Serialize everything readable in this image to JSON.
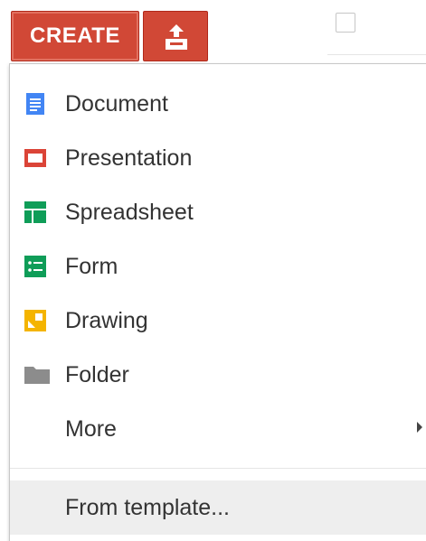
{
  "toolbar": {
    "create_label": "CREATE",
    "upload_icon": "upload-icon",
    "select_checkbox_checked": false
  },
  "menu": {
    "items": [
      {
        "label": "Document",
        "icon": "document-icon",
        "color": "#4285f4"
      },
      {
        "label": "Presentation",
        "icon": "presentation-icon",
        "color": "#db4437"
      },
      {
        "label": "Spreadsheet",
        "icon": "spreadsheet-icon",
        "color": "#0f9d58"
      },
      {
        "label": "Form",
        "icon": "form-icon",
        "color": "#0f9d58"
      },
      {
        "label": "Drawing",
        "icon": "drawing-icon",
        "color": "#f4b400"
      },
      {
        "label": "Folder",
        "icon": "folder-icon",
        "color": "#8c8c8c"
      },
      {
        "label": "More",
        "icon": "chevron-right-icon",
        "has_submenu": true
      },
      {
        "label": "From template...",
        "highlighted": true
      }
    ]
  },
  "colors": {
    "accent": "#d14836",
    "text": "#333333",
    "highlight": "#eeeeee"
  }
}
